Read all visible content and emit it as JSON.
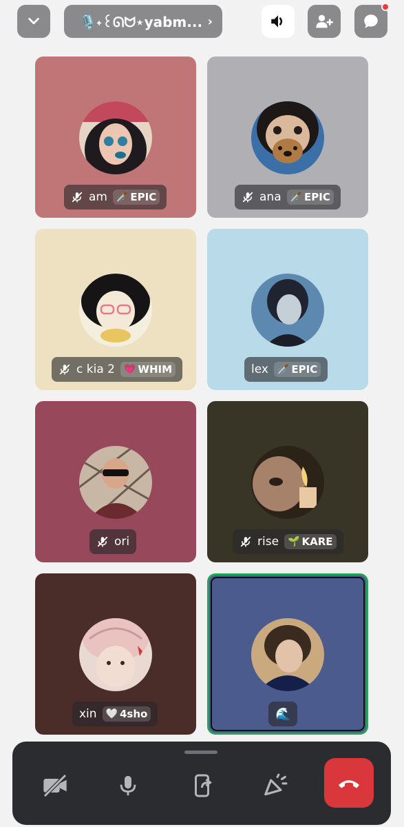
{
  "header": {
    "channel_name": "🎙️˖꒰ᘏᗢ⋆yabm...",
    "chevron": "›",
    "icons": [
      "chevron-down-icon",
      "speaker-icon",
      "invite-user-icon",
      "chat-icon"
    ]
  },
  "participants": [
    {
      "name": "am",
      "tag": "EPIC",
      "tag_icon": "🗡️",
      "muted": true,
      "bg": "#c07677"
    },
    {
      "name": "ana",
      "tag": "EPIC",
      "tag_icon": "🗡️",
      "muted": true,
      "bg": "#b0afb4"
    },
    {
      "name": "c kia 2",
      "tag": "WHIM",
      "tag_icon": "💗",
      "muted": true,
      "bg": "#ede1c2"
    },
    {
      "name": "lex",
      "tag": "EPIC",
      "tag_icon": "🗡️",
      "muted": false,
      "bg": "#b9dae8"
    },
    {
      "name": "ori",
      "tag": "",
      "tag_icon": "",
      "muted": true,
      "bg": "#97495b"
    },
    {
      "name": "rise",
      "tag": "KARE",
      "tag_icon": "🌱",
      "muted": true,
      "bg": "#383526"
    },
    {
      "name": "xin",
      "tag": "4sho",
      "tag_icon": "🤍",
      "muted": false,
      "bg": "#4a2c29"
    },
    {
      "name": "",
      "tag": "",
      "tag_icon": "🌊",
      "muted": false,
      "bg": "#4c5b8d",
      "speaking": true
    }
  ],
  "controls": {
    "icons": [
      "camera-off-icon",
      "microphone-icon",
      "screen-share-icon",
      "soundboard-icon",
      "end-call-icon"
    ],
    "end_call_color": "#da373c"
  }
}
